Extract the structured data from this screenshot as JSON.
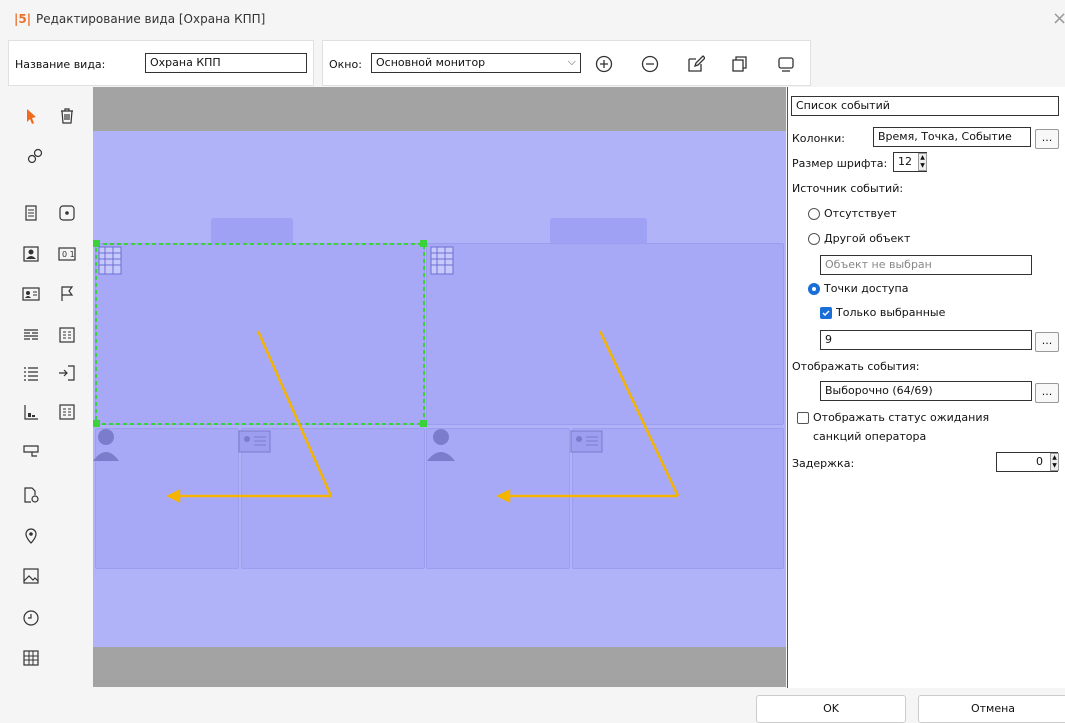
{
  "window": {
    "app_logo": "|5|",
    "title": "Редактирование вида [Охрана КПП]",
    "close_glyph": "×"
  },
  "toolbar": {
    "view_name_label": "Название вида:",
    "view_name_value": "Охрана КПП",
    "window_label": "Окно:",
    "window_value": "Основной монитор"
  },
  "properties": {
    "element_name": "Список событий",
    "columns_label": "Колонки:",
    "columns_value": "Время, Точка, Событие",
    "font_size_label": "Размер шрифта:",
    "font_size_value": "12",
    "event_source_label": "Источник событий:",
    "source_none": "Отсутствует",
    "source_other": "Другой объект",
    "object_placeholder": "Объект не выбран",
    "source_access_points": "Точки доступа",
    "only_selected": "Только выбранные",
    "selected_value": "9",
    "display_events_label": "Отображать события:",
    "display_events_value": "Выборочно (64/69)",
    "show_sanction_line1": "Отображать статус ожидания",
    "show_sanction_line2": "санкций оператора",
    "delay_label": "Задержка:",
    "delay_value": "0",
    "ellipsis": "..."
  },
  "footer": {
    "ok_label": "OK",
    "cancel_label": "Отмена"
  },
  "colors": {
    "accent": "#1a6ed8",
    "canvas_blue": "#b1b3f9",
    "arrow": "#f5b400",
    "selection": "#3ad13a"
  }
}
